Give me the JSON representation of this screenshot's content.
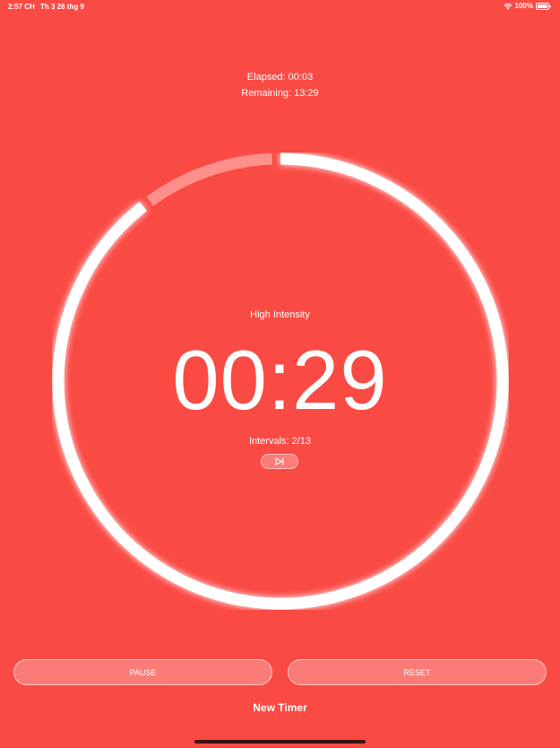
{
  "status_bar": {
    "time": "2:57 CH",
    "date": "Th 3 26 thg 9",
    "battery": "100%"
  },
  "timer": {
    "elapsed": "Elapsed: 00:03",
    "remaining": "Remaining: 13:29",
    "interval_name": "High Intensity",
    "countdown": "00:29",
    "intervals": "Intervals: 2/13",
    "interval_progress_fraction": 0.1
  },
  "controls": {
    "pause_label": "PAUSE",
    "reset_label": "RESET",
    "new_timer_label": "New Timer"
  },
  "icons": {
    "skip": "skip-forward-icon",
    "wifi": "wifi-icon",
    "battery": "battery-icon"
  },
  "colors": {
    "background": "#fa4a44",
    "ring": "#ffffff",
    "ring_progress": "#ff8f8a"
  }
}
